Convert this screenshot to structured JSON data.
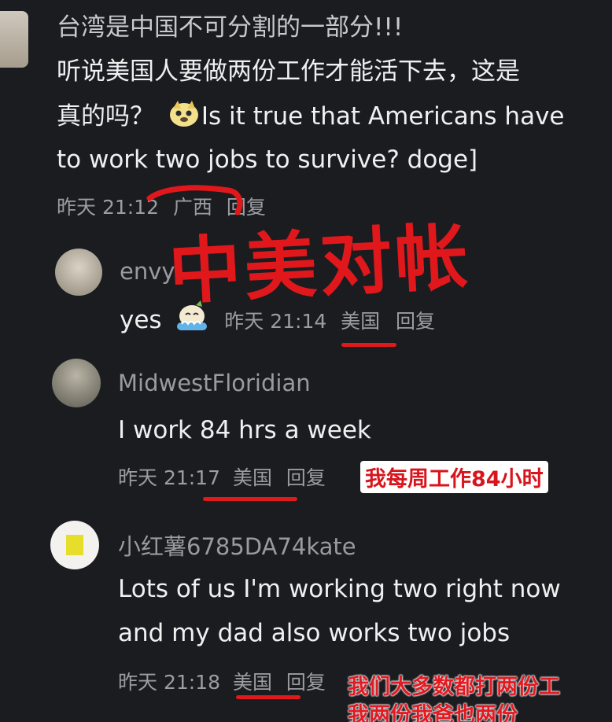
{
  "comment1": {
    "line1": "台湾是中国不可分割的一部分!!!",
    "line2": "听说美国人要做两份工作才能活下去，这是",
    "line3_cn": "真的吗？",
    "line3_en": "Is it true that Americans have",
    "line4": "to work two jobs to survive? doge]",
    "meta_time": "昨天 21:12",
    "meta_location": "广西",
    "meta_reply": "回复"
  },
  "overlay_title": "中美对帐",
  "comment2": {
    "username": "envy",
    "text": "yes",
    "meta_time": "昨天 21:14",
    "meta_location": "美国",
    "meta_reply": "回复"
  },
  "comment3": {
    "username": "MidwestFloridian",
    "text": "I work 84 hrs a week",
    "meta_time": "昨天 21:17",
    "meta_location": "美国",
    "meta_reply": "回复",
    "caption": "我每周工作84小时"
  },
  "comment4": {
    "username": "小红薯6785DA74kate",
    "line1": "Lots of us I'm working two right now",
    "line2": "and my dad also works two jobs",
    "meta_time": "昨天 21:18",
    "meta_location": "美国",
    "meta_reply": "回复",
    "caption_line1": "我们大多数都打两份工",
    "caption_line2": "我两份我爸也两份"
  },
  "colors": {
    "background": "#1b1c20",
    "highlight_red": "#e0181c",
    "meta_gray": "#9c9ca2"
  },
  "icons": [
    "doge-emoji",
    "crying-emoji"
  ]
}
